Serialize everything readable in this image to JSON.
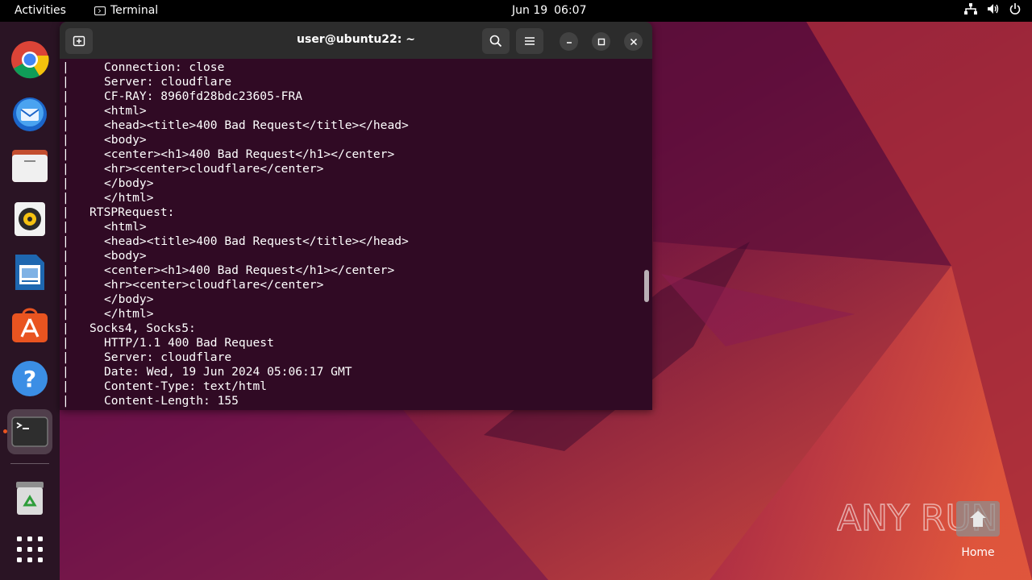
{
  "topbar": {
    "activities": "Activities",
    "app_name": "Terminal",
    "date": "Jun 19",
    "time": "06:07"
  },
  "dock": {
    "items": [
      {
        "name": "Google Chrome",
        "icon": "chrome-icon"
      },
      {
        "name": "Thunderbird Mail",
        "icon": "thunderbird-icon"
      },
      {
        "name": "Files",
        "icon": "files-icon"
      },
      {
        "name": "Rhythmbox",
        "icon": "rhythmbox-icon"
      },
      {
        "name": "LibreOffice Writer",
        "icon": "writer-icon"
      },
      {
        "name": "Ubuntu Software",
        "icon": "software-icon"
      },
      {
        "name": "Help",
        "icon": "help-icon"
      },
      {
        "name": "Terminal",
        "icon": "terminal-icon",
        "active": true
      },
      {
        "name": "Trash",
        "icon": "trash-icon"
      },
      {
        "name": "Show Applications",
        "icon": "app-grid-icon"
      }
    ]
  },
  "terminal": {
    "title": "user@ubuntu22: ~",
    "lines": [
      {
        "indent": 2,
        "text": "Connection: close"
      },
      {
        "indent": 2,
        "text": "Server: cloudflare"
      },
      {
        "indent": 2,
        "text": "CF-RAY: 8960fd28bdc23605-FRA"
      },
      {
        "indent": 2,
        "text": "<html>"
      },
      {
        "indent": 2,
        "text": "<head><title>400 Bad Request</title></head>"
      },
      {
        "indent": 2,
        "text": "<body>"
      },
      {
        "indent": 2,
        "text": "<center><h1>400 Bad Request</h1></center>"
      },
      {
        "indent": 2,
        "text": "<hr><center>cloudflare</center>"
      },
      {
        "indent": 2,
        "text": "</body>"
      },
      {
        "indent": 2,
        "text": "</html>"
      },
      {
        "indent": 1,
        "text": "RTSPRequest:"
      },
      {
        "indent": 2,
        "text": "<html>"
      },
      {
        "indent": 2,
        "text": "<head><title>400 Bad Request</title></head>"
      },
      {
        "indent": 2,
        "text": "<body>"
      },
      {
        "indent": 2,
        "text": "<center><h1>400 Bad Request</h1></center>"
      },
      {
        "indent": 2,
        "text": "<hr><center>cloudflare</center>"
      },
      {
        "indent": 2,
        "text": "</body>"
      },
      {
        "indent": 2,
        "text": "</html>"
      },
      {
        "indent": 1,
        "text": "Socks4, Socks5:"
      },
      {
        "indent": 2,
        "text": "HTTP/1.1 400 Bad Request"
      },
      {
        "indent": 2,
        "text": "Server: cloudflare"
      },
      {
        "indent": 2,
        "text": "Date: Wed, 19 Jun 2024 05:06:17 GMT"
      },
      {
        "indent": 2,
        "text": "Content-Type: text/html"
      },
      {
        "indent": 2,
        "text": "Content-Length: 155"
      }
    ],
    "line_prefix": "|"
  },
  "desktop": {
    "home_label": "Home",
    "watermark": "ANY RUN"
  },
  "colors": {
    "terminal_bg": "#300a24",
    "titlebar_bg": "#2c2c2c",
    "accent": "#e95420"
  }
}
